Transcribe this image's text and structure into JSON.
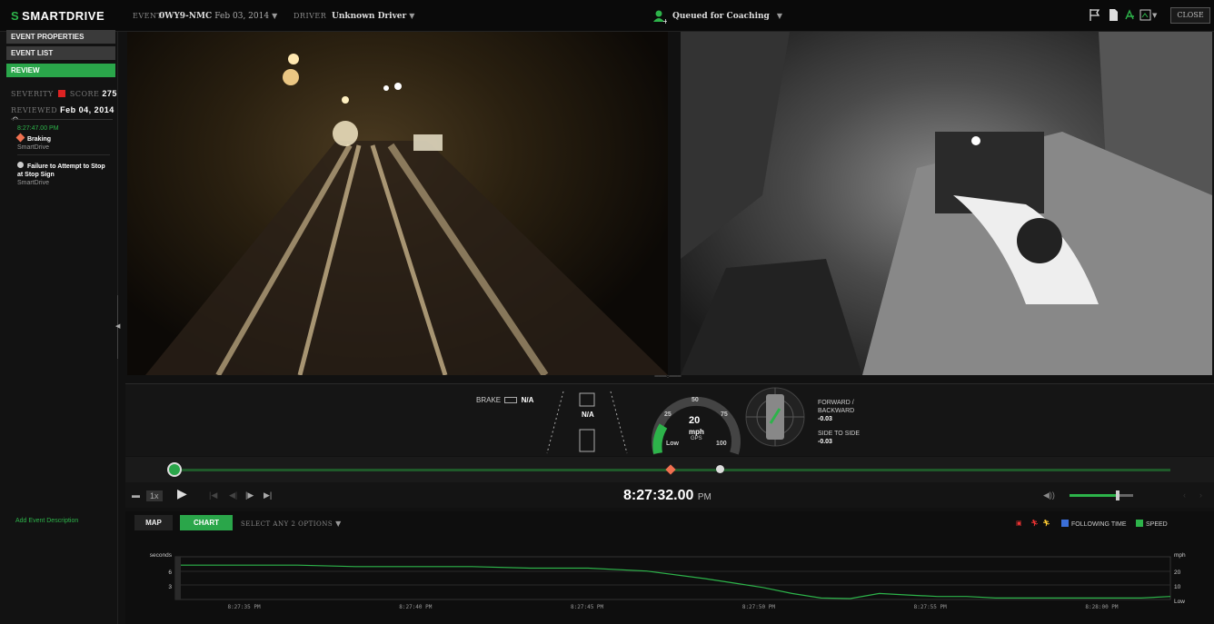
{
  "header": {
    "logo_text": "SMARTDRIVE",
    "event_label": "EVENT",
    "event_id": "0WY9-NMC",
    "event_date": "Feb 03, 2014",
    "driver_label": "DRIVER",
    "driver_value": "Unknown Driver",
    "coaching_status": "Queued for Coaching",
    "close_label": "CLOSE"
  },
  "sidebar": {
    "buttons": [
      "EVENT PROPERTIES",
      "EVENT LIST",
      "REVIEW"
    ],
    "severity_label": "SEVERITY",
    "score_label": "SCORE",
    "score_value": "275",
    "reviewed_label": "REVIEWED",
    "reviewed_date": "Feb 04, 2014",
    "event_time": "8:27:47.00 PM",
    "events": [
      {
        "title": "Braking",
        "source": "SmartDrive",
        "icon": "diamond-icon"
      },
      {
        "title": "Failure to Attempt to Stop at Stop Sign",
        "source": "SmartDrive",
        "icon": "dot-icon"
      }
    ],
    "add_description": "Add Event Description"
  },
  "gauges": {
    "brake_label": "BRAKE",
    "brake_value": "N/A",
    "lane_value": "N/A",
    "speed_ticks": [
      "25",
      "50",
      "75",
      "100"
    ],
    "speed_value": "20",
    "speed_unit": "mph",
    "speed_source": "GPS",
    "speed_low": "Low",
    "fb_label_1": "FORWARD /",
    "fb_label_2": "BACKWARD",
    "fb_value": "-0.03",
    "side_label": "SIDE TO SIDE",
    "side_value": "-0.03"
  },
  "player": {
    "rate": "1x",
    "time": "8:27:32.00",
    "ampm": "PM",
    "position_fraction": 0.0,
    "volume_fraction": 0.75
  },
  "chart_panel": {
    "tabs": [
      "MAP",
      "CHART"
    ],
    "select_label": "SELECT ANY 2 OPTIONS",
    "legend": [
      {
        "label": "FOLLOWING TIME",
        "color": "#3b6fd8"
      },
      {
        "label": "SPEED",
        "color": "#2db34a"
      }
    ]
  },
  "chart_data": {
    "type": "line",
    "ylabel": "seconds",
    "y2label": "mph",
    "yticks": [
      "6",
      "3"
    ],
    "y2ticks": [
      "20",
      "10",
      "Low"
    ],
    "xticks": [
      "8:27:35 PM",
      "8:27:40 PM",
      "8:27:45 PM",
      "8:27:50 PM",
      "8:27:55 PM",
      "8:28:00 PM"
    ],
    "series": [
      {
        "name": "SPEED",
        "color": "#2db34a",
        "x_seconds": [
          0,
          2,
          4,
          6,
          8,
          10,
          12,
          14,
          16,
          18,
          19,
          20,
          21,
          22,
          23,
          24,
          25,
          26,
          27,
          28,
          29,
          30,
          31,
          32,
          33,
          34
        ],
        "values": [
          23,
          23,
          23,
          22,
          22,
          22,
          21,
          21,
          19,
          14,
          11,
          8,
          4,
          1,
          0.5,
          4,
          3,
          2,
          2,
          1,
          1,
          1,
          1,
          1,
          1,
          2
        ]
      }
    ],
    "xlim": [
      "8:27:33 PM",
      "8:28:02 PM"
    ],
    "y2lim": [
      0,
      30
    ]
  }
}
